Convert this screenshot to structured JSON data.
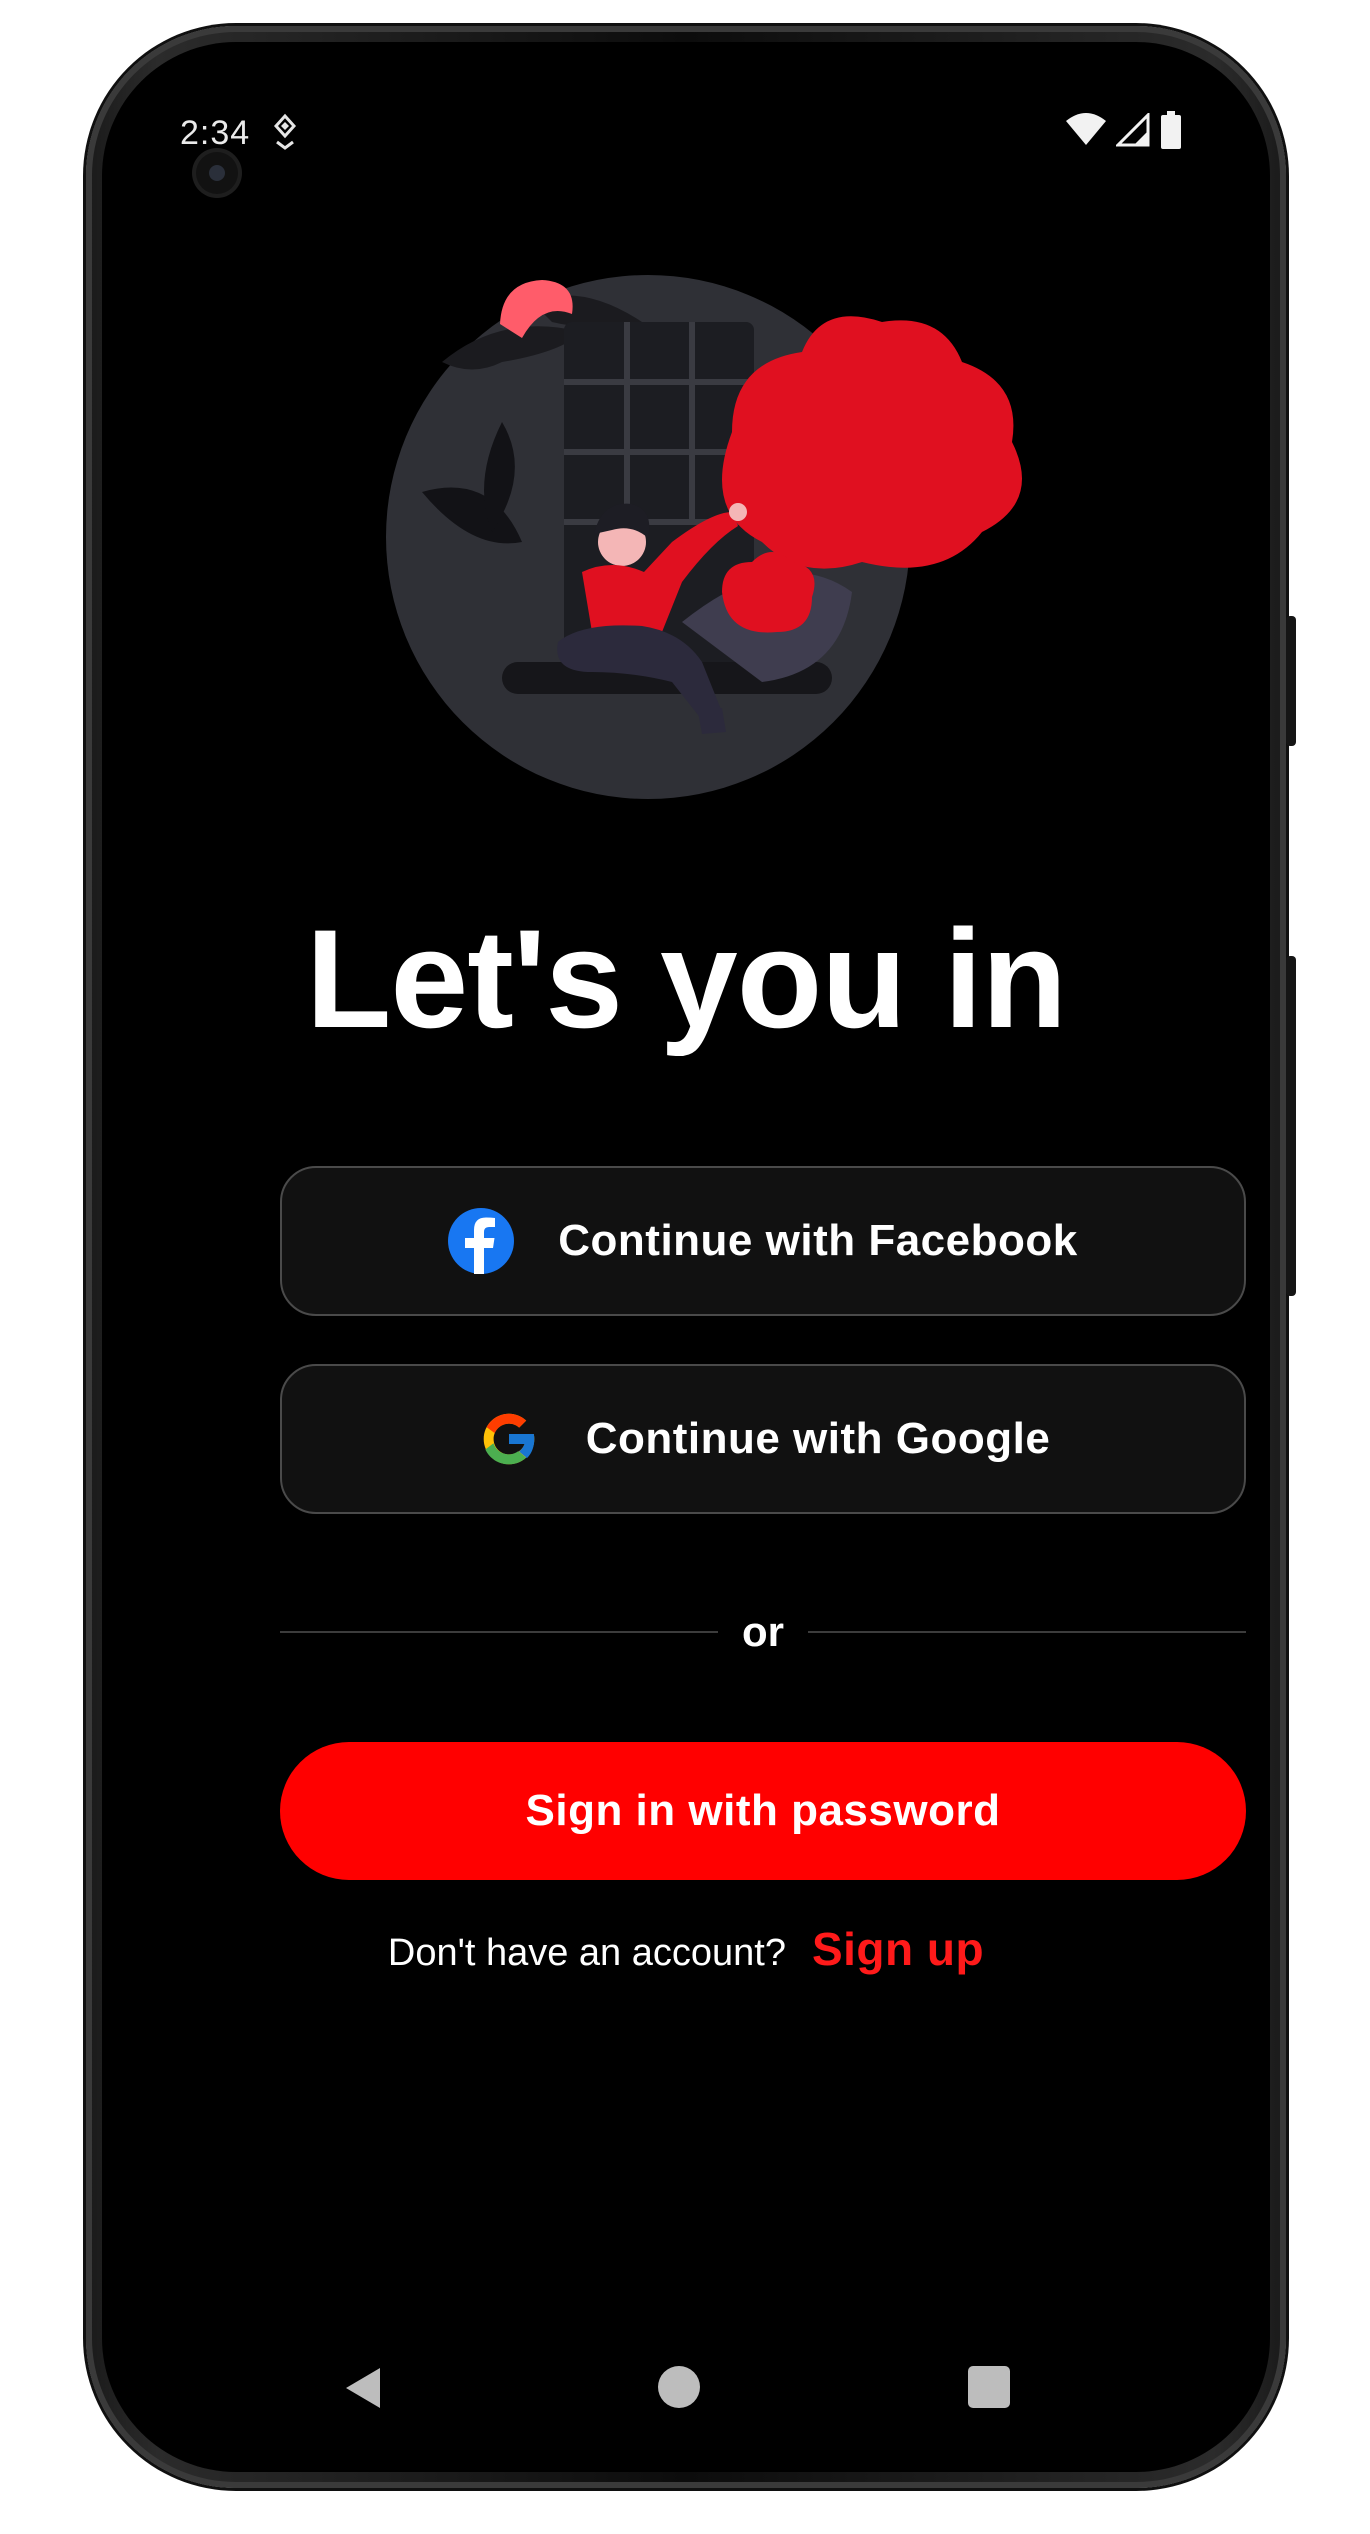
{
  "status_bar": {
    "time": "2:34",
    "icons": [
      "location-icon",
      "wifi-icon",
      "signal-icon",
      "battery-icon"
    ]
  },
  "main": {
    "title": "Let's you in",
    "buttons": {
      "facebook_label": "Continue with Facebook",
      "google_label": "Continue with Google",
      "password_label": "Sign in with password"
    },
    "divider_text": "or",
    "signup_prompt": "Don't have an account?",
    "signup_link": "Sign up"
  },
  "navigation": {
    "buttons": [
      "back-icon",
      "home-icon",
      "recents-icon"
    ]
  },
  "colors": {
    "background": "#000000",
    "accent": "#ff0000",
    "button_surface": "#111111",
    "button_border": "#4a4a4a",
    "facebook_blue": "#1877f2"
  }
}
